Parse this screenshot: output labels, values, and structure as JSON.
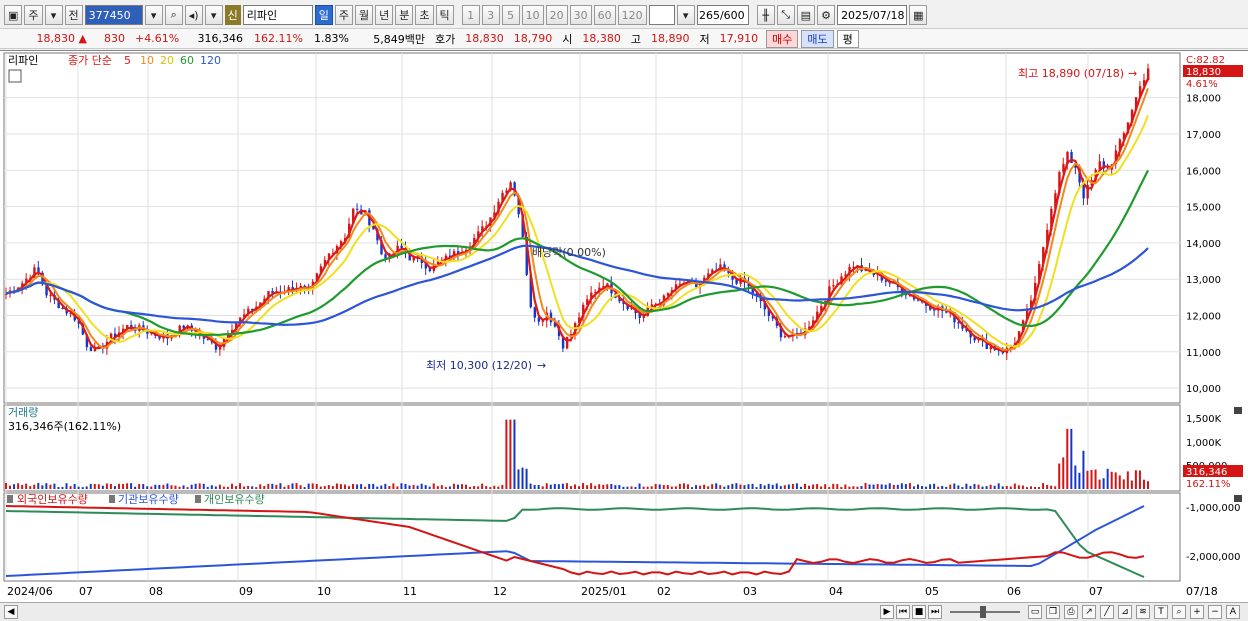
{
  "toolbar": {
    "period_type": "주",
    "prev_label": "전",
    "code": "377450",
    "credit_badge": "신",
    "stock_name": "리파인",
    "periods": [
      "일",
      "주",
      "월",
      "년",
      "분",
      "초",
      "틱"
    ],
    "active_period": "일",
    "intervals": [
      "1",
      "3",
      "5",
      "10",
      "20",
      "30",
      "60",
      "120"
    ],
    "count": "265",
    "count_total": "/600",
    "date": "2025/07/18"
  },
  "quote": {
    "price": "18,830",
    "change": "830",
    "change_pct": "+4.61%",
    "volume": "316,346",
    "volume_ratio": "162.11%",
    "turnover": "1.83%",
    "amount": "5,849백만",
    "hoga_label": "호가",
    "ask": "18,830",
    "bid": "18,790",
    "open_label": "시",
    "open": "18,380",
    "high_label": "고",
    "high": "18,890",
    "low_label": "저",
    "low": "17,910",
    "buy_label": "매수",
    "sell_label": "매도",
    "flat_label": "평"
  },
  "price_panel": {
    "legend_name": "리파인",
    "legend_ma_title": "종가 단순",
    "ma_periods": [
      "5",
      "10",
      "20",
      "60",
      "120"
    ],
    "ma_colors": [
      "#e01818",
      "#f08a1a",
      "#f0e020",
      "#1f9b2e",
      "#2c55d8"
    ],
    "y_ticks": [
      "18,000",
      "17,000",
      "16,000",
      "15,000",
      "14,000",
      "13,000",
      "12,000",
      "11,000",
      "10,000"
    ],
    "current_c": "C:82.82",
    "current_price_tag": "18,830",
    "current_pct_tag": "4.61%",
    "high_annotation": "최고 18,890 (07/18)",
    "low_annotation": "최저 10,300 (12/20)",
    "dividend_annotation": "배당락(0.00%)"
  },
  "volume_panel": {
    "title": "거래량",
    "current_text": "316,346주(162.11%)",
    "y_ticks": [
      "1,500K",
      "1,000K",
      "500,000"
    ],
    "current_tag": "316,346",
    "current_pct_tag": "162.11%"
  },
  "holdings_panel": {
    "legend": [
      "외국인보유수량",
      "기관보유수량",
      "개인보유수량"
    ],
    "colors": [
      "#d31515",
      "#2c55d8",
      "#2e8b57"
    ],
    "y_ticks": [
      "-1,000,000",
      "-2,000,000"
    ]
  },
  "x_axis": {
    "labels": [
      "2024/06",
      "07",
      "08",
      "09",
      "10",
      "11",
      "12",
      "2025/01",
      "02",
      "03",
      "04",
      "05",
      "06",
      "07"
    ],
    "right_label": "07/18"
  },
  "chart_data": {
    "type": "line",
    "price_ylim": [
      9700,
      18900
    ],
    "close_path": [
      [
        0,
        12600
      ],
      [
        8,
        12900
      ],
      [
        15,
        13300
      ],
      [
        20,
        12600
      ],
      [
        28,
        12200
      ],
      [
        35,
        11900
      ],
      [
        40,
        11200
      ],
      [
        45,
        11000
      ],
      [
        52,
        11400
      ],
      [
        60,
        11700
      ],
      [
        68,
        11600
      ],
      [
        75,
        11450
      ],
      [
        80,
        11400
      ],
      [
        88,
        11700
      ],
      [
        95,
        11500
      ],
      [
        100,
        11300
      ],
      [
        105,
        11100
      ],
      [
        110,
        11600
      ],
      [
        118,
        12000
      ],
      [
        125,
        12300
      ],
      [
        130,
        12600
      ],
      [
        138,
        12700
      ],
      [
        145,
        12800
      ],
      [
        150,
        12600
      ],
      [
        155,
        13200
      ],
      [
        160,
        13700
      ],
      [
        168,
        14200
      ],
      [
        172,
        14900
      ],
      [
        178,
        14800
      ],
      [
        182,
        14400
      ],
      [
        186,
        13700
      ],
      [
        190,
        13600
      ],
      [
        195,
        13900
      ],
      [
        200,
        13600
      ],
      [
        206,
        13500
      ],
      [
        210,
        13300
      ],
      [
        216,
        13500
      ],
      [
        222,
        13700
      ],
      [
        228,
        13900
      ],
      [
        235,
        14300
      ],
      [
        240,
        14700
      ],
      [
        245,
        15300
      ],
      [
        250,
        15700
      ],
      [
        253,
        15200
      ],
      [
        256,
        14100
      ],
      [
        260,
        12300
      ],
      [
        264,
        11800
      ],
      [
        268,
        12100
      ],
      [
        272,
        11700
      ],
      [
        276,
        11200
      ],
      [
        280,
        11500
      ],
      [
        285,
        12100
      ],
      [
        290,
        12600
      ],
      [
        296,
        12900
      ],
      [
        300,
        12700
      ],
      [
        305,
        12400
      ],
      [
        310,
        12200
      ],
      [
        315,
        11900
      ],
      [
        320,
        12300
      ],
      [
        325,
        12400
      ],
      [
        330,
        12700
      ],
      [
        336,
        12900
      ],
      [
        342,
        12800
      ],
      [
        348,
        13100
      ],
      [
        354,
        13300
      ],
      [
        360,
        13000
      ],
      [
        366,
        12900
      ],
      [
        372,
        12500
      ],
      [
        378,
        12000
      ],
      [
        384,
        11500
      ],
      [
        390,
        11400
      ],
      [
        396,
        11600
      ],
      [
        402,
        12100
      ],
      [
        408,
        12700
      ],
      [
        414,
        13100
      ],
      [
        420,
        13400
      ],
      [
        426,
        13200
      ],
      [
        432,
        13100
      ],
      [
        438,
        12900
      ],
      [
        444,
        12700
      ],
      [
        450,
        12500
      ],
      [
        456,
        12300
      ],
      [
        462,
        12200
      ],
      [
        468,
        12000
      ],
      [
        474,
        11700
      ],
      [
        480,
        11400
      ],
      [
        485,
        11200
      ],
      [
        490,
        11100
      ],
      [
        495,
        11000
      ],
      [
        500,
        11300
      ],
      [
        505,
        11900
      ],
      [
        510,
        12800
      ],
      [
        514,
        13900
      ],
      [
        518,
        15000
      ],
      [
        522,
        15900
      ],
      [
        526,
        16400
      ],
      [
        530,
        16100
      ],
      [
        534,
        15300
      ],
      [
        538,
        15700
      ],
      [
        542,
        16200
      ],
      [
        546,
        16000
      ],
      [
        550,
        16500
      ],
      [
        554,
        17000
      ],
      [
        558,
        17700
      ],
      [
        562,
        18300
      ],
      [
        566,
        18830
      ]
    ],
    "volume_note": "spike ~1,500K at 12; spike ~1,300K mid-06; current 316,346",
    "holdings_series": [
      {
        "name": "외국인보유수량",
        "trend": "flat high, drop after 12, recover in 03-06"
      },
      {
        "name": "기관보유수량",
        "trend": "rising from low to mid, spike up in 06-07"
      },
      {
        "name": "개인보유수량",
        "trend": "near top, sharp drop in late 06-07"
      }
    ]
  }
}
